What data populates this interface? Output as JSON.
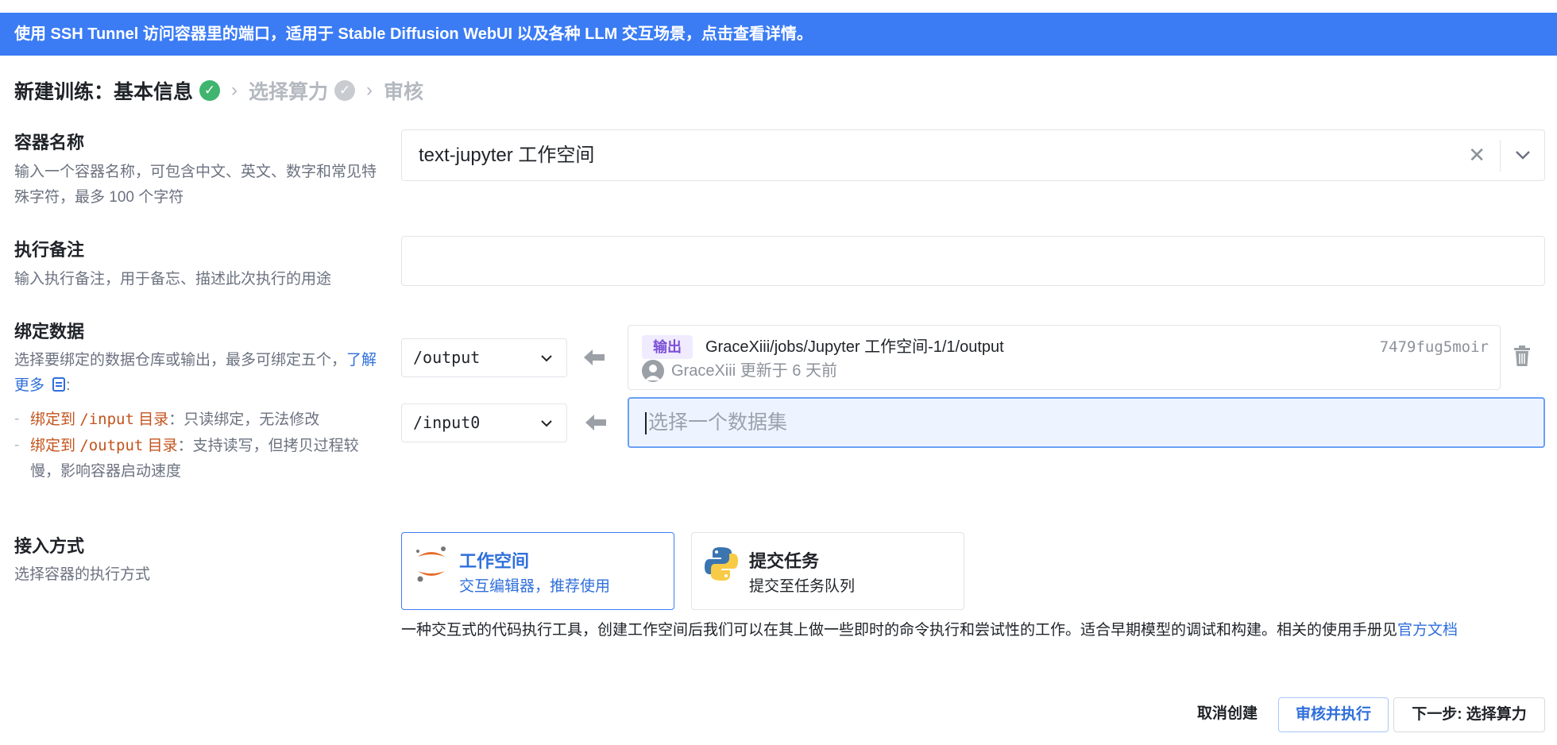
{
  "banner": {
    "text": "使用 SSH Tunnel 访问容器里的端口，适用于 Stable Diffusion WebUI 以及各种 LLM 交互场景，点击查看详情。"
  },
  "steps": [
    {
      "label": "新建训练：基本信息",
      "status": "done"
    },
    {
      "label": "选择算力",
      "status": "pending"
    },
    {
      "label": "审核",
      "status": "pending"
    }
  ],
  "container_name": {
    "title": "容器名称",
    "desc": "输入一个容器名称，可包含中文、英文、数字和常见特殊字符，最多 100 个字符",
    "value": "text-jupyter 工作空间"
  },
  "note": {
    "title": "执行备注",
    "desc": "输入执行备注，用于备忘、描述此次执行的用途",
    "value": ""
  },
  "bind_data": {
    "title": "绑定数据",
    "desc": "选择要绑定的数据仓库或输出，最多可绑定五个，",
    "learn_more": "了解更多",
    "colon": ":",
    "rule1_prefix": "绑定到",
    "rule1_path": "/input",
    "rule1_suffix": "目录",
    "rule1_text": "：只读绑定，无法修改",
    "rule2_prefix": "绑定到",
    "rule2_path": "/output",
    "rule2_suffix": "目录",
    "rule2_text": "：支持读写，但拷贝过程较慢，影响容器启动速度",
    "rows": [
      {
        "mount": "/output",
        "badge": "输出",
        "path": "GraceXiii/jobs/Jupyter 工作空间-1/1/output",
        "id": "7479fug5moir",
        "user": "GraceXiii",
        "updated": "更新于 6 天前"
      },
      {
        "mount": "/input0",
        "placeholder": "选择一个数据集"
      }
    ]
  },
  "access": {
    "title": "接入方式",
    "desc": "选择容器的执行方式",
    "options": [
      {
        "title": "工作空间",
        "sub": "交互编辑器，推荐使用",
        "icon": "jupyter-icon",
        "selected": true
      },
      {
        "title": "提交任务",
        "sub": "提交至任务队列",
        "icon": "python-icon",
        "selected": false
      }
    ],
    "explain": "一种交互式的代码执行工具，创建工作空间后我们可以在其上做一些即时的命令执行和尝试性的工作。适合早期模型的调试和构建。相关的使用手册见",
    "doc_link": "官方文档"
  },
  "footer": {
    "cancel": "取消创建",
    "review": "审核并执行",
    "next": "下一步: 选择算力"
  },
  "colors": {
    "primary": "#3b7cf5",
    "success": "#3fb56f",
    "accent_orange": "#c4531c",
    "badge_purple": "#7b4fd6"
  }
}
